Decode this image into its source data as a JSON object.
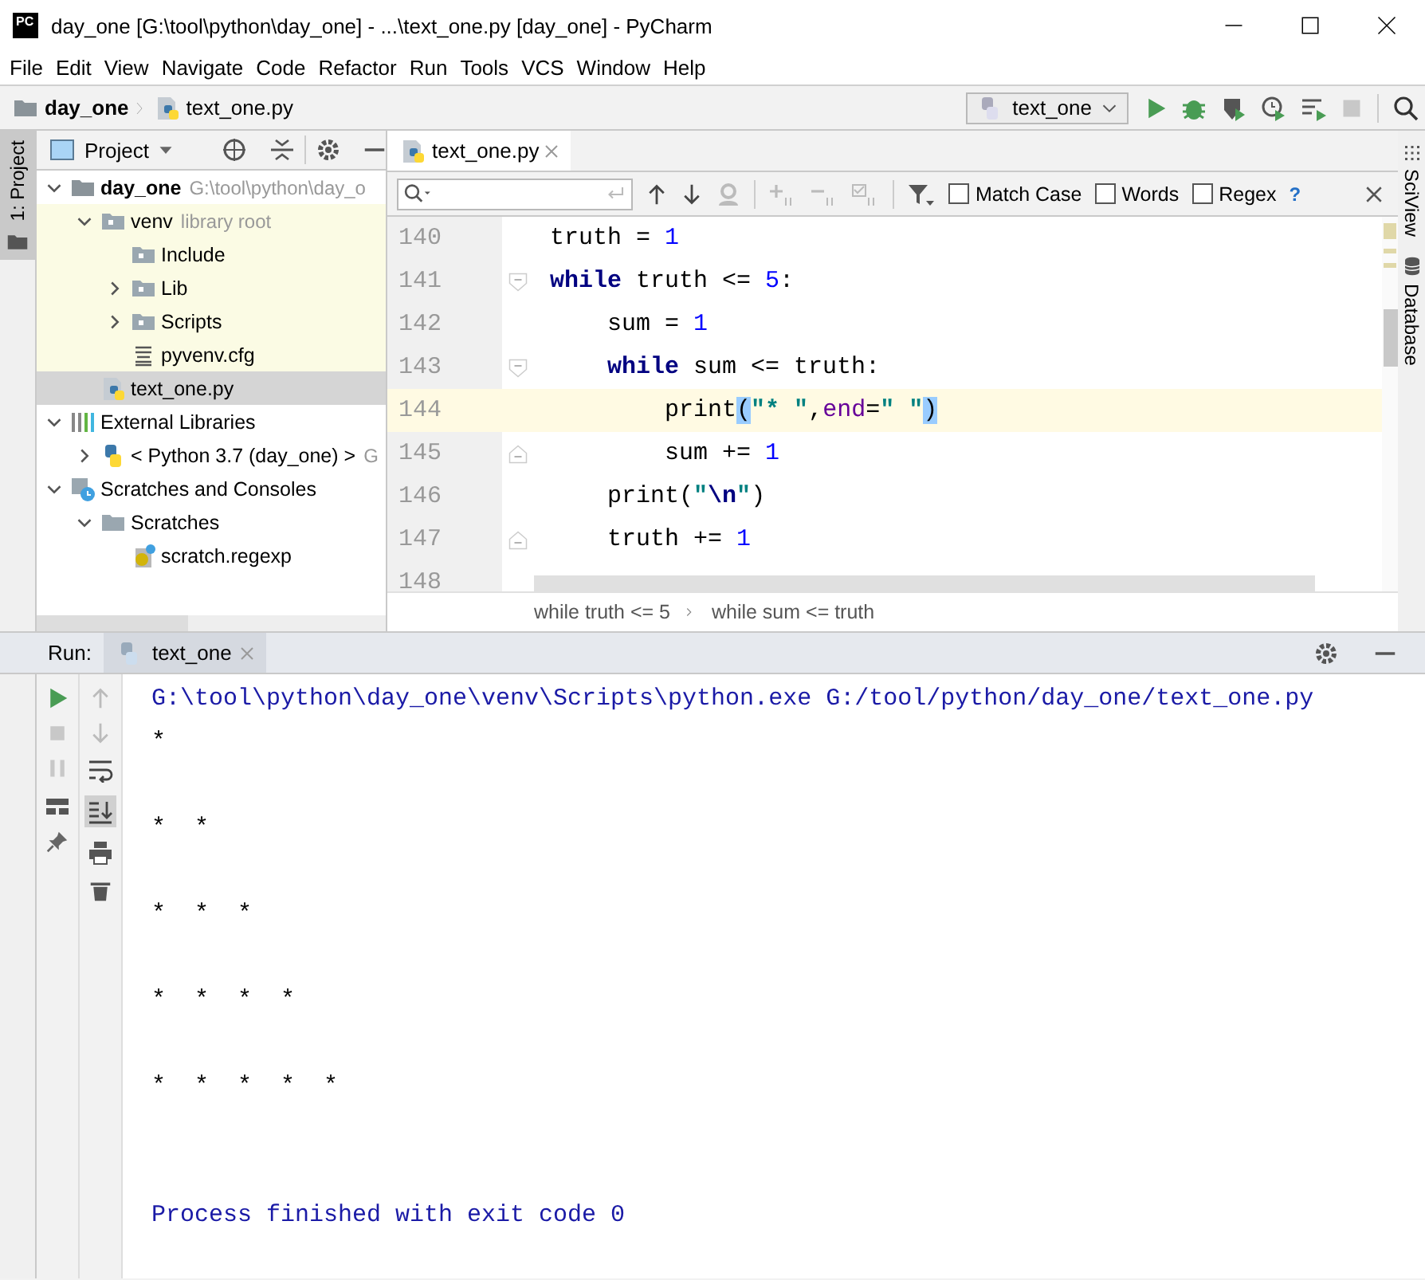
{
  "window": {
    "logo": "PC",
    "title": "day_one [G:\\tool\\python\\day_one] - ...\\text_one.py [day_one] - PyCharm"
  },
  "menu": [
    "File",
    "Edit",
    "View",
    "Navigate",
    "Code",
    "Refactor",
    "Run",
    "Tools",
    "VCS",
    "Window",
    "Help"
  ],
  "navigation": {
    "breadcrumb": [
      {
        "label": "day_one",
        "kind": "project_root"
      },
      {
        "label": "text_one.py",
        "kind": "python_file"
      }
    ],
    "run_config": "text_one"
  },
  "left_tool_strip": [
    {
      "label": "1: Project",
      "selected": true
    }
  ],
  "project_panel": {
    "title": "Project",
    "tree": [
      {
        "label": "day_one",
        "hint": "G:\\tool\\python\\day_o",
        "kind": "project_root",
        "expanded": true,
        "selected": false,
        "highlighted": false,
        "children": [
          {
            "label": "venv",
            "hint": "library root",
            "kind": "module_folder",
            "expanded": true,
            "selected": false,
            "highlighted": true,
            "children": [
              {
                "label": "Include",
                "kind": "module_folder",
                "selected": false,
                "highlighted": true
              },
              {
                "label": "Lib",
                "kind": "module_folder",
                "expanded": false,
                "selected": false,
                "highlighted": true
              },
              {
                "label": "Scripts",
                "kind": "module_folder",
                "expanded": false,
                "selected": false,
                "highlighted": true
              },
              {
                "label": "pyvenv.cfg",
                "kind": "text_file",
                "selected": false,
                "highlighted": true
              }
            ]
          },
          {
            "label": "text_one.py",
            "kind": "python_file",
            "selected": true,
            "highlighted": false
          }
        ]
      },
      {
        "label": "External Libraries",
        "kind": "libraries",
        "expanded": true,
        "selected": false,
        "highlighted": false,
        "children": [
          {
            "label": "< Python 3.7 (day_one) >",
            "hint": "G",
            "kind": "python_sdk",
            "expanded": false,
            "selected": false,
            "highlighted": false
          }
        ]
      },
      {
        "label": "Scratches and Consoles",
        "kind": "scratches",
        "expanded": true,
        "selected": false,
        "highlighted": false,
        "children": [
          {
            "label": "Scratches",
            "kind": "folder",
            "expanded": true,
            "selected": false,
            "highlighted": false,
            "children": [
              {
                "label": "scratch.regexp",
                "kind": "regexp_file",
                "selected": false,
                "highlighted": false
              }
            ]
          }
        ]
      }
    ]
  },
  "editor": {
    "tabs": [
      {
        "label": "text_one.py",
        "selected": true
      }
    ],
    "find": {
      "options": [
        {
          "label": "Match Case",
          "checked": false
        },
        {
          "label": "Words",
          "checked": false
        },
        {
          "label": "Regex",
          "checked": false
        }
      ],
      "help": "?"
    },
    "lines": [
      {
        "number": "140",
        "current": false,
        "fold_start": false,
        "fold_end": false,
        "tokens": [
          {
            "kind": "plain",
            "text": "truth = "
          },
          {
            "kind": "num",
            "text": "1"
          }
        ]
      },
      {
        "number": "141",
        "current": false,
        "fold_start": true,
        "fold_end": false,
        "tokens": [
          {
            "kind": "kw",
            "text": "while"
          },
          {
            "kind": "plain",
            "text": " truth <= "
          },
          {
            "kind": "num",
            "text": "5"
          },
          {
            "kind": "plain",
            "text": ":"
          }
        ]
      },
      {
        "number": "142",
        "current": false,
        "fold_start": false,
        "fold_end": false,
        "tokens": [
          {
            "kind": "plain",
            "text": "    sum = "
          },
          {
            "kind": "num",
            "text": "1"
          }
        ]
      },
      {
        "number": "143",
        "current": false,
        "fold_start": true,
        "fold_end": false,
        "tokens": [
          {
            "kind": "kw",
            "text": "    while"
          },
          {
            "kind": "plain",
            "text": " sum <= truth:"
          }
        ]
      },
      {
        "number": "144",
        "current": true,
        "fold_start": false,
        "fold_end": false,
        "tokens": [
          {
            "kind": "plain",
            "text": "        print"
          },
          {
            "kind": "match",
            "text": "("
          },
          {
            "kind": "str",
            "text": "\"* \""
          },
          {
            "kind": "plain",
            "text": ","
          },
          {
            "kind": "param",
            "text": "end"
          },
          {
            "kind": "plain",
            "text": "="
          },
          {
            "kind": "str",
            "text": "\" \""
          },
          {
            "kind": "match",
            "text": ")"
          }
        ]
      },
      {
        "number": "145",
        "current": false,
        "fold_start": false,
        "fold_end": true,
        "tokens": [
          {
            "kind": "plain",
            "text": "        sum += "
          },
          {
            "kind": "num",
            "text": "1"
          }
        ]
      },
      {
        "number": "146",
        "current": false,
        "fold_start": false,
        "fold_end": false,
        "tokens": [
          {
            "kind": "plain",
            "text": "    print("
          },
          {
            "kind": "str",
            "text": "\""
          },
          {
            "kind": "esc",
            "text": "\\n"
          },
          {
            "kind": "str",
            "text": "\""
          },
          {
            "kind": "plain",
            "text": ")"
          }
        ]
      },
      {
        "number": "147",
        "current": false,
        "fold_start": false,
        "fold_end": true,
        "tokens": [
          {
            "kind": "plain",
            "text": "    truth += "
          },
          {
            "kind": "num",
            "text": "1"
          }
        ]
      },
      {
        "number": "148",
        "current": false,
        "fold_start": false,
        "fold_end": false
      }
    ],
    "breadcrumb": [
      "while truth <= 5",
      "while sum <= truth"
    ]
  },
  "right_tool_strip": [
    {
      "label": "SciView",
      "kind": "sciview"
    },
    {
      "label": "Database",
      "kind": "database"
    }
  ],
  "run": {
    "title": "Run:",
    "tabs": [
      {
        "label": "text_one",
        "selected": true
      }
    ],
    "output": [
      {
        "kind": "command",
        "text": "G:\\tool\\python\\day_one\\venv\\Scripts\\python.exe G:/tool/python/day_one/text_one.py"
      },
      {
        "kind": "stdout",
        "text": "*\n\n*  *\n\n*  *  *\n\n*  *  *  *\n\n*  *  *  *  *"
      },
      {
        "kind": "blank"
      },
      {
        "kind": "blank"
      },
      {
        "kind": "exit",
        "text": "Process finished with exit code 0"
      }
    ]
  }
}
